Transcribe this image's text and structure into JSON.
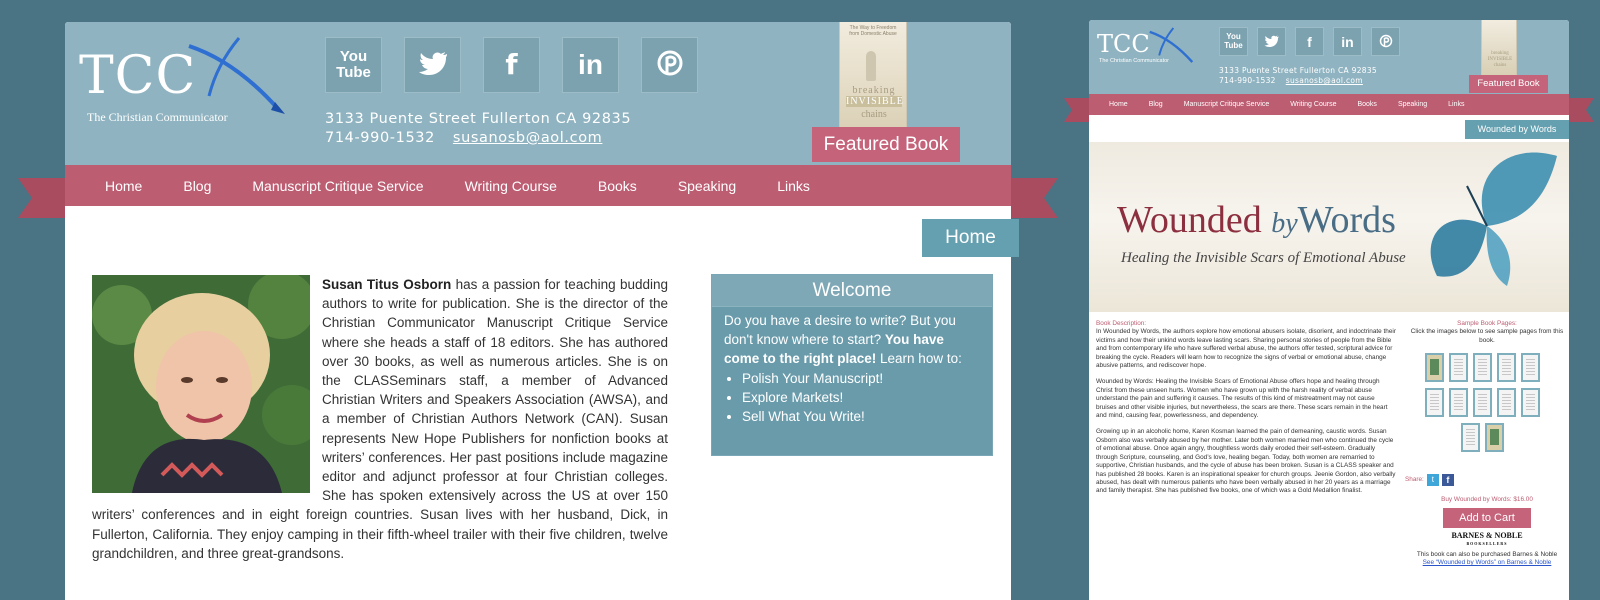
{
  "colors": {
    "background": "#4a7384",
    "header": "#8fb3c0",
    "nav": "#bd5d72",
    "accent_teal": "#65a0b0",
    "featured": "#c4637a"
  },
  "site": {
    "logo_text": "TCC",
    "logo_tagline": "The Christian Communicator",
    "address": "3133 Puente Street Fullerton CA 92835",
    "phone": "714-990-1532",
    "email": "susanosb@aol.com",
    "social": [
      {
        "name": "youtube-icon",
        "glyph": "You\nTube"
      },
      {
        "name": "twitter-icon",
        "glyph": "🐦"
      },
      {
        "name": "facebook-icon",
        "glyph": "f"
      },
      {
        "name": "linkedin-icon",
        "glyph": "in"
      },
      {
        "name": "pinterest-icon",
        "glyph": "ⓟ"
      }
    ],
    "featured_label": "Featured Book",
    "book_cover": {
      "tagline": "The Way to Freedom from Domestic Abuse",
      "line1": "breaking",
      "line2": "INVISIBLE",
      "line3": "chains"
    },
    "nav": [
      "Home",
      "Blog",
      "Manuscript Critique Service",
      "Writing Course",
      "Books",
      "Speaking",
      "Links"
    ]
  },
  "home_page": {
    "page_button": "Home",
    "bio_name": "Susan Titus Osborn",
    "bio_text": " has a passion for teaching budding authors to write for publication. She is the director of the Christian Communicator Manuscript Critique Service where she heads a staff of 18 editors. She has authored over 30 books, as well as numerous articles. She is on the CLASSeminars staff, a member of Advanced Christian Writers and Speakers Association (AWSA), and a member of Christian Authors Network (CAN). Susan represents New Hope Publishers for nonfiction books at writers’ conferences. Her past positions include magazine editor and adjunct professor at four Christian colleges. She has spoken extensively across the US at over 150 writers’ conferences and in eight foreign countries. Susan lives with her husband, Dick, in Fullerton, California. They enjoy camping in their fifth-wheel trailer with their five children, twelve grandchildren, and three great-grandsons.",
    "welcome": {
      "title": "Welcome",
      "intro": "Do you have a desire to write? But you don't know where to start? ",
      "intro_bold": "You have come to the right place!",
      "intro_end": " Learn how to:",
      "items": [
        "Polish Your Manuscript!",
        "Explore Markets!",
        "Sell What You Write!"
      ]
    }
  },
  "book_page": {
    "page_button": "Wounded by Words",
    "banner_title_a": "Wounded ",
    "banner_title_by": "by",
    "banner_title_b": "Words",
    "banner_subtitle": "Healing the Invisible Scars of Emotional Abuse",
    "desc_label": "Book Description:",
    "paragraphs": [
      "In Wounded by Words, the authors explore how emotional abusers isolate, disorient, and indoctrinate their victims and how their unkind words leave lasting scars. Sharing personal stories of people from the Bible and from contemporary life who have suffered verbal abuse, the authors offer tested, scriptural advice for breaking the cycle. Readers will learn how to recognize the signs of verbal or emotional abuse, change abusive patterns, and rediscover hope.",
      "Wounded by Words: Healing the Invisible Scars of Emotional Abuse offers hope and healing through Christ from these unseen hurts. Women who have grown up with the harsh reality of verbal abuse understand the pain and suffering it causes. The results of this kind of mistreatment may not cause bruises and other visible injuries, but nevertheless, the scars are there. These scars remain in the heart and mind, causing fear, powerlessness, and dependency.",
      "Growing up in an alcoholic home, Karen Kosman learned the pain of demeaning, caustic words. Susan Osborn also was verbally abused by her mother. Later both women married men who continued the cycle of emotional abuse. Once again angry, thoughtless words daily eroded their self-esteem. Gradually through Scripture, counseling, and God’s love, healing began. Today, both women are remarried to supportive, Christian husbands, and the cycle of abuse has been broken. Susan is a CLASS speaker and has published 28 books. Karen is an inspirational speaker for church groups. Jeenie Gordon, also verbally abused, has dealt with numerous patients who have been verbally abused in her 20 years as a marriage and family therapist. She has published five books, one of which was a Gold Medallion finalist."
    ],
    "sample_label": "Sample Book Pages:",
    "sample_hint": "Click the images below to see sample pages from this book.",
    "share_label": "Share:",
    "buy_label": "Buy Wounded by Words: $16.00",
    "cart_button": "Add to Cart",
    "bn_logo": "BARNES & NOBLE",
    "bn_logo_sub": "BOOKSELLERS",
    "also_text": "This book can also be purchased Barnes & Noble",
    "bn_link": "See “Wounded by Words” on Barnes & Noble"
  }
}
